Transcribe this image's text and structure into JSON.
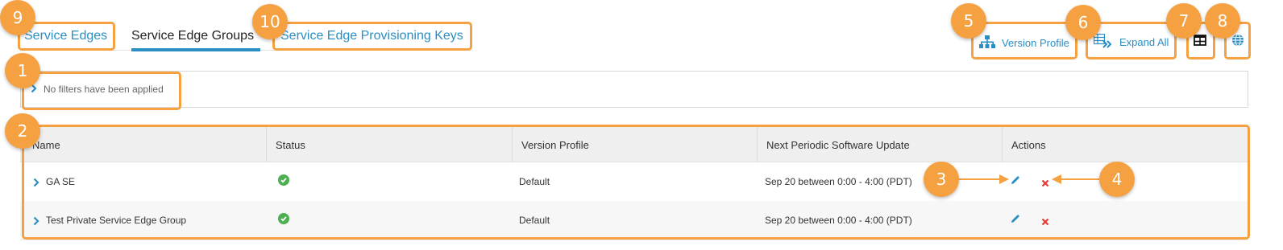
{
  "tabs": [
    {
      "label": "Service Edges",
      "state": "link"
    },
    {
      "label": "Service Edge Groups",
      "state": "active"
    },
    {
      "label": "Service Edge Provisioning Keys",
      "state": "link"
    }
  ],
  "toolbar": {
    "version_profile": "Version Profile",
    "expand_all": "Expand All"
  },
  "filter": {
    "text": "No filters have been applied"
  },
  "table": {
    "columns": [
      "Name",
      "Status",
      "Version Profile",
      "Next Periodic Software Update",
      "Actions"
    ],
    "rows": [
      {
        "name": "GA SE",
        "status": "ok",
        "version_profile": "Default",
        "next_update": "Sep 20 between 0:00 - 4:00 (PDT)"
      },
      {
        "name": "Test Private Service Edge Group",
        "status": "ok",
        "version_profile": "Default",
        "next_update": "Sep 20 between 0:00 - 4:00 (PDT)"
      }
    ]
  },
  "callouts": [
    "1",
    "2",
    "3",
    "4",
    "5",
    "6",
    "7",
    "8",
    "9",
    "10"
  ],
  "colors": {
    "accent": "#2a8ec4",
    "callout": "#f5a142",
    "status_ok": "#4caf50",
    "delete": "#e53935"
  },
  "icons": {
    "version_profile": "org-chart-icon",
    "expand_all": "expand-table-icon",
    "columns": "table-columns-icon",
    "globe": "globe-icon"
  }
}
